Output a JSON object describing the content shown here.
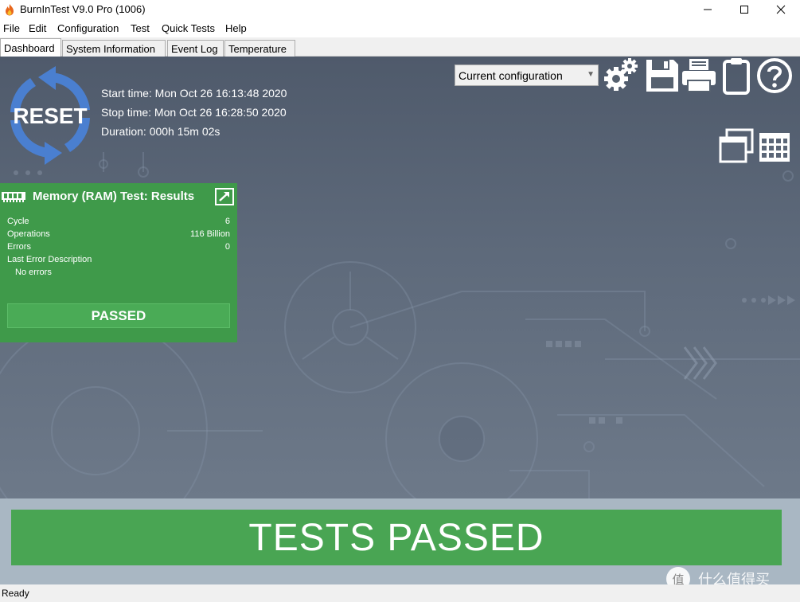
{
  "window": {
    "title": "BurnInTest V9.0 Pro (1006)",
    "minimize_icon": "minimize-icon",
    "maximize_icon": "maximize-icon",
    "close_icon": "close-icon"
  },
  "menu": [
    "File",
    "Edit",
    "Configuration",
    "Test",
    "Quick Tests",
    "Help"
  ],
  "tabs": [
    {
      "label": "Dashboard",
      "active": true
    },
    {
      "label": "System Information",
      "active": false
    },
    {
      "label": "Event Log",
      "active": false
    },
    {
      "label": "Temperature",
      "active": false
    }
  ],
  "dashboard": {
    "reset_label": "RESET",
    "start_time": "Start time: Mon Oct 26 16:13:48 2020",
    "stop_time": "Stop time: Mon Oct 26 16:28:50 2020",
    "duration": "Duration: 000h 15m 02s",
    "config_value": "Current configuration",
    "toolbar_icons": [
      "settings-icon",
      "save-icon",
      "print-icon",
      "clipboard-icon",
      "help-icon"
    ],
    "view_icons": [
      "windows-view-icon",
      "grid-view-icon"
    ]
  },
  "memory_panel": {
    "title": "Memory (RAM) Test: Results",
    "stats": [
      {
        "label": "Cycle",
        "value": "6"
      },
      {
        "label": "Operations",
        "value": "116 Billion"
      },
      {
        "label": "Errors",
        "value": "0"
      }
    ],
    "last_error_label": "Last Error Description",
    "last_error_value": "No errors",
    "status": "PASSED"
  },
  "result": {
    "banner": "TESTS PASSED",
    "watermark": "值 什么值得买"
  },
  "status_bar": {
    "text": "Ready"
  },
  "colors": {
    "pass_green": "#49a553",
    "dashboard_bg": "#5e6a7b",
    "reset_blue": "#4a7fd0"
  }
}
